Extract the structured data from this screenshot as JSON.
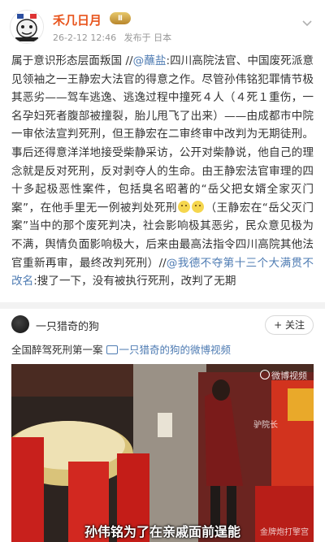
{
  "header": {
    "username": "禾几日月",
    "badge": "Ⅱ",
    "date": "26-2-12 12:46",
    "source": "发布于 日本"
  },
  "post": {
    "p1": "属于意识形态层面叛国 //",
    "m1": "@蘸盐",
    "p2": ":四川高院法官、中国废死派意见领袖之一王静宏大法官的得意之作。尽管孙伟铭犯罪情节极其恶劣——驾车逃逸、逃逸过程中撞死４人（４死１重伤，一名孕妇死者腹部被撞裂，胎儿甩飞了出来）——由成都市中院一审依法宣判死刑，但王静宏在二审终审中改判为无期徒刑。事后还得意洋洋地接受柴静采访，公开对柴静说，他自己的理念就是反对死刑，反对剥夺人的生命。由王静宏法官审理的四十多起极恶性案件，包括臭名昭著的“岳父把女婿全家灭门案”，在他手里无一例被判处死刑",
    "p3": "（王静宏在“岳父灭门案”当中的那个废死判决，社会影响极其恶劣，民众意见极为不满，舆情负面影响极大，后来由最高法指令四川高院其他法官重新再审，最终改判死刑）//",
    "m2": "@我德不夺第十三个大满贯不改名",
    "p4": ":搜了一下，没有被执行死刑，改判了无期"
  },
  "repost": {
    "name": "一只猎奇的狗",
    "follow": "+ 关注"
  },
  "video": {
    "title": "全国醉驾死刑第一案",
    "link": "一只猎奇的狗的微博视频",
    "watermark": "微博视频",
    "watermark2": "驴院长",
    "subtitle": "孙伟铭为了在亲戚面前逞能",
    "watermark3": "金牌炮打擎宫"
  },
  "colors": {
    "username": "#e8541c",
    "link": "#4f7cb3"
  }
}
